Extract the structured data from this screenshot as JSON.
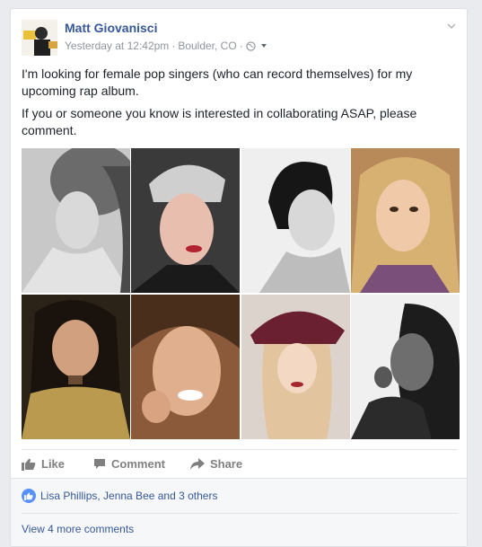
{
  "post": {
    "author": "Matt Giovanisci",
    "timestamp": "Yesterday at 12:42pm",
    "location": "Boulder, CO",
    "separator": "·",
    "privacy_icon": "globe-icon",
    "menu_icon": "chevron-down-icon",
    "paragraphs": [
      "I'm looking for female pop singers (who can record themselves) for my upcoming rap album.",
      "If you or someone you know is interested in collaborating ASAP, please comment."
    ],
    "photos": [
      "photo-1",
      "photo-2",
      "photo-3",
      "photo-4",
      "photo-5",
      "photo-6",
      "photo-7",
      "photo-8"
    ]
  },
  "actions": {
    "like": "Like",
    "comment": "Comment",
    "share": "Share"
  },
  "reactions": {
    "summary": "Lisa Phillips, Jenna Bee and 3 others",
    "view_more": "View 4 more comments"
  },
  "colors": {
    "link": "#365899",
    "meta": "#90949c",
    "action": "#7f7f7f",
    "like_badge": "#5890ff"
  }
}
